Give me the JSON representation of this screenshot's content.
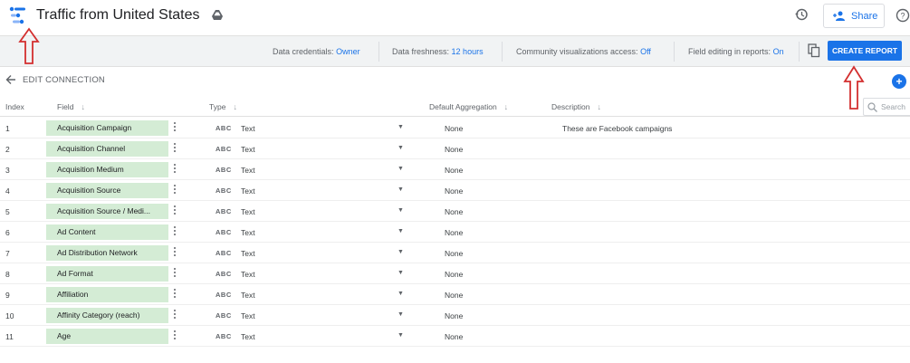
{
  "header": {
    "title": "Traffic from United States",
    "share_label": "Share"
  },
  "infobar": {
    "credentials_label": "Data credentials:",
    "credentials_value": "Owner",
    "freshness_label": "Data freshness:",
    "freshness_value": "12 hours",
    "community_label": "Community visualizations access:",
    "community_value": "Off",
    "editing_label": "Field editing in reports:",
    "editing_value": "On",
    "create_report_label": "CREATE REPORT"
  },
  "edit": {
    "label": "EDIT CONNECTION",
    "add_label": "+"
  },
  "table": {
    "headers": {
      "index": "Index",
      "field": "Field",
      "type": "Type",
      "aggregation": "Default Aggregation",
      "description": "Description"
    },
    "search_placeholder": "Search",
    "type_badge": "ABC",
    "rows": [
      {
        "index": "1",
        "field": "Acquisition Campaign",
        "type": "Text",
        "aggregation": "None",
        "description": "These are Facebook campaigns"
      },
      {
        "index": "2",
        "field": "Acquisition Channel",
        "type": "Text",
        "aggregation": "None",
        "description": ""
      },
      {
        "index": "3",
        "field": "Acquisition Medium",
        "type": "Text",
        "aggregation": "None",
        "description": ""
      },
      {
        "index": "4",
        "field": "Acquisition Source",
        "type": "Text",
        "aggregation": "None",
        "description": ""
      },
      {
        "index": "5",
        "field": "Acquisition Source / Medi...",
        "type": "Text",
        "aggregation": "None",
        "description": ""
      },
      {
        "index": "6",
        "field": "Ad Content",
        "type": "Text",
        "aggregation": "None",
        "description": ""
      },
      {
        "index": "7",
        "field": "Ad Distribution Network",
        "type": "Text",
        "aggregation": "None",
        "description": ""
      },
      {
        "index": "8",
        "field": "Ad Format",
        "type": "Text",
        "aggregation": "None",
        "description": ""
      },
      {
        "index": "9",
        "field": "Affiliation",
        "type": "Text",
        "aggregation": "None",
        "description": ""
      },
      {
        "index": "10",
        "field": "Affinity Category (reach)",
        "type": "Text",
        "aggregation": "None",
        "description": ""
      },
      {
        "index": "11",
        "field": "Age",
        "type": "Text",
        "aggregation": "None",
        "description": ""
      }
    ]
  },
  "colors": {
    "accent": "#1a73e8",
    "field_chip": "#d4ecd5",
    "annotation_arrow": "#d32f2f"
  }
}
